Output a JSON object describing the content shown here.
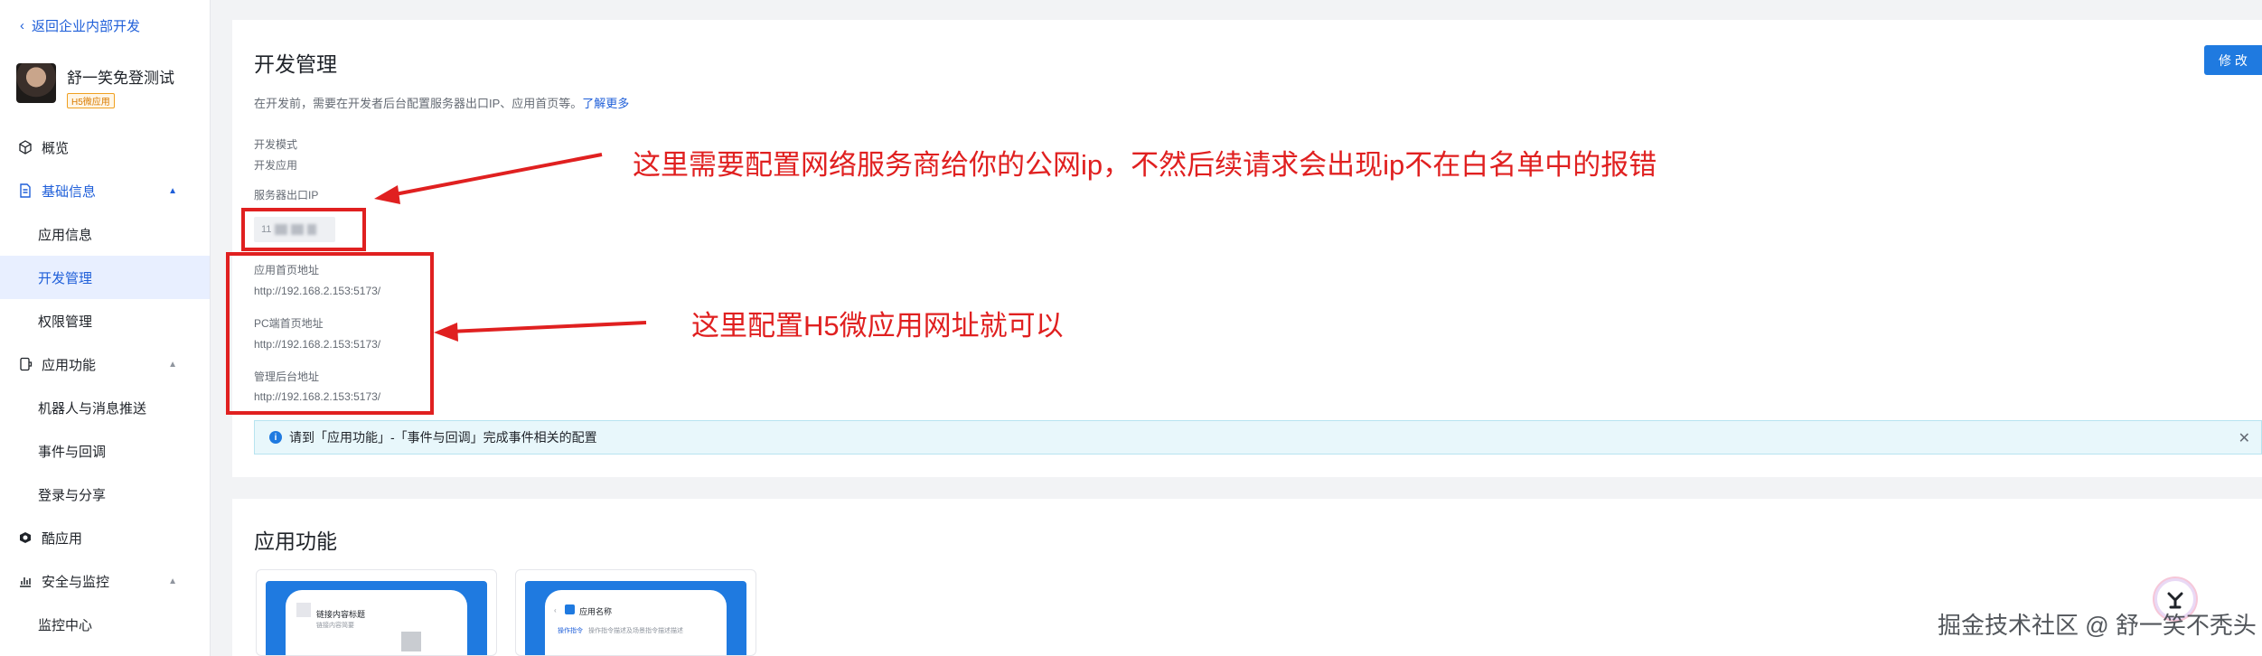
{
  "sidebar": {
    "back_label": "返回企业内部开发",
    "app_name": "舒一笑免登测试",
    "app_tag": "H5微应用",
    "items": [
      {
        "label": "概览"
      },
      {
        "label": "基础信息"
      },
      {
        "label": "应用信息"
      },
      {
        "label": "开发管理"
      },
      {
        "label": "权限管理"
      },
      {
        "label": "应用功能"
      },
      {
        "label": "机器人与消息推送"
      },
      {
        "label": "事件与回调"
      },
      {
        "label": "登录与分享"
      },
      {
        "label": "酷应用"
      },
      {
        "label": "安全与监控"
      },
      {
        "label": "监控中心"
      }
    ]
  },
  "dev": {
    "title": "开发管理",
    "edit_label": "修 改",
    "desc_text": "在开发前，需要在开发者后台配置服务器出口IP、应用首页等。",
    "desc_link": "了解更多",
    "mode_label": "开发模式",
    "mode_value": "开发应用",
    "ip_label": "服务器出口IP",
    "ip_value_partial": "11",
    "home_label": "应用首页地址",
    "home_value": "http://192.168.2.153:5173/",
    "pc_label": "PC端首页地址",
    "pc_value": "http://192.168.2.153:5173/",
    "admin_label": "管理后台地址",
    "admin_value": "http://192.168.2.153:5173/",
    "info_text": "请到「应用功能」-「事件与回调」完成事件相关的配置"
  },
  "annotations": {
    "ip_note": "这里需要配置网络服务商给你的公网ip，不然后续请求会出现ip不在白名单中的报错",
    "url_note": "这里配置H5微应用网址就可以"
  },
  "features": {
    "title": "应用功能",
    "card1_title": "链接内容标题",
    "card1_sub": "链接内容简要",
    "card2_title": "应用名称",
    "card2_sub_label": "操作指令",
    "card2_sub_text": "操作指令描述及场景指令描述描述"
  },
  "watermark": "掘金技术社区 @ 舒一笑不秃头",
  "colors": {
    "accent": "#1f7ae0",
    "annotation": "#e02020"
  }
}
